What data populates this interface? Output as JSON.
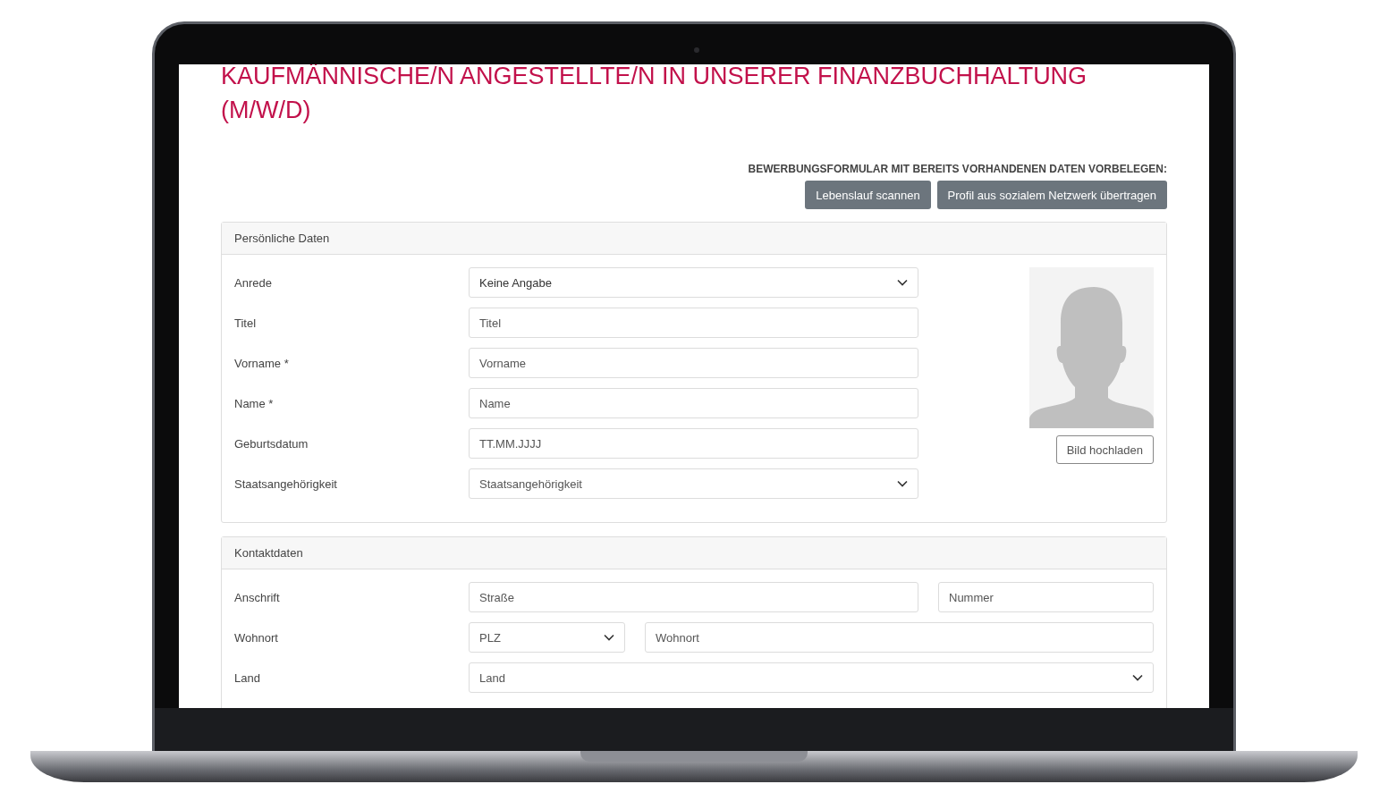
{
  "page": {
    "title": "KAUFMÄNNISCHE/N ANGESTELLTE/N IN UNSERER FINANZBUCHHALTUNG (M/W/D)",
    "prefill": {
      "label": "BEWERBUNGSFORMULAR MIT BEREITS VORHANDENEN DATEN VORBELEGEN:",
      "buttons": [
        "Lebenslauf scannen",
        "Profil aus sozialem Netzwerk übertragen"
      ]
    },
    "sections": [
      {
        "heading": "Persönliche Daten",
        "photo": {
          "button": "Bild hochladen"
        },
        "rows": [
          {
            "label": "Anrede",
            "controls": [
              {
                "kind": "select",
                "value": "Keine Angabe"
              }
            ]
          },
          {
            "label": "Titel",
            "controls": [
              {
                "kind": "input",
                "placeholder": "Titel"
              }
            ]
          },
          {
            "label": "Vorname *",
            "controls": [
              {
                "kind": "input",
                "placeholder": "Vorname"
              }
            ]
          },
          {
            "label": "Name *",
            "controls": [
              {
                "kind": "input",
                "placeholder": "Name"
              }
            ]
          },
          {
            "label": "Geburtsdatum",
            "controls": [
              {
                "kind": "input",
                "placeholder": "TT.MM.JJJJ"
              }
            ]
          },
          {
            "label": "Staatsangehörigkeit",
            "controls": [
              {
                "kind": "select",
                "placeholder": "Staatsangehörigkeit"
              }
            ]
          }
        ]
      },
      {
        "heading": "Kontaktdaten",
        "rows": [
          {
            "label": "Anschrift",
            "controls": [
              {
                "kind": "input",
                "placeholder": "Straße"
              },
              {
                "kind": "input",
                "placeholder": "Nummer"
              }
            ]
          },
          {
            "label": "Wohnort",
            "controls": [
              {
                "kind": "select",
                "placeholder": "PLZ"
              },
              {
                "kind": "input",
                "placeholder": "Wohnort"
              }
            ]
          },
          {
            "label": "Land",
            "controls": [
              {
                "kind": "select",
                "placeholder": "Land"
              }
            ]
          }
        ]
      }
    ]
  }
}
